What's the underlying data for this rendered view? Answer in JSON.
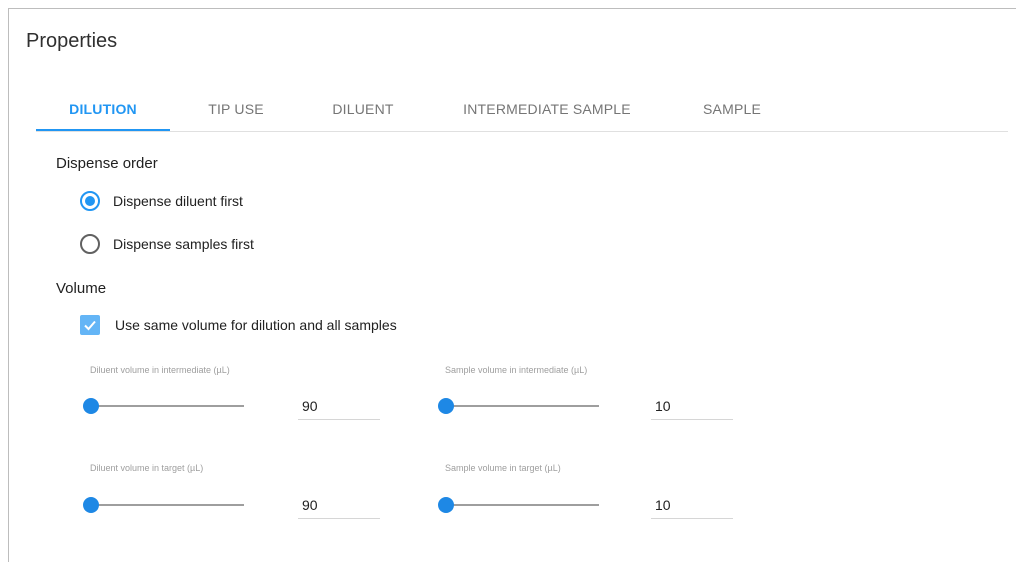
{
  "panel": {
    "title": "Properties"
  },
  "tabs": [
    {
      "label": "DILUTION",
      "active": true
    },
    {
      "label": "TIP USE",
      "active": false
    },
    {
      "label": "DILUENT",
      "active": false
    },
    {
      "label": "INTERMEDIATE SAMPLE",
      "active": false
    },
    {
      "label": "SAMPLE",
      "active": false
    }
  ],
  "dispense_order": {
    "heading": "Dispense order",
    "options": [
      {
        "label": "Dispense diluent first",
        "selected": true
      },
      {
        "label": "Dispense samples first",
        "selected": false
      }
    ]
  },
  "volume": {
    "heading": "Volume",
    "same_volume_checkbox": {
      "label": "Use same volume for dilution and all samples",
      "checked": true
    },
    "fields": {
      "diluent_intermediate": {
        "label": "Diluent volume in intermediate (µL)",
        "value": "90",
        "slider_level": 0
      },
      "sample_intermediate": {
        "label": "Sample volume in intermediate (µL)",
        "value": "10",
        "slider_level": 0
      },
      "diluent_target": {
        "label": "Diluent volume in target (µL)",
        "value": "90",
        "slider_level": 0
      },
      "sample_target": {
        "label": "Sample volume in target (µL)",
        "value": "10",
        "slider_level": 0
      }
    }
  },
  "colors": {
    "accent": "#2196f3",
    "checkbox": "#64b5f6",
    "slider_thumb": "#1e88e5"
  }
}
